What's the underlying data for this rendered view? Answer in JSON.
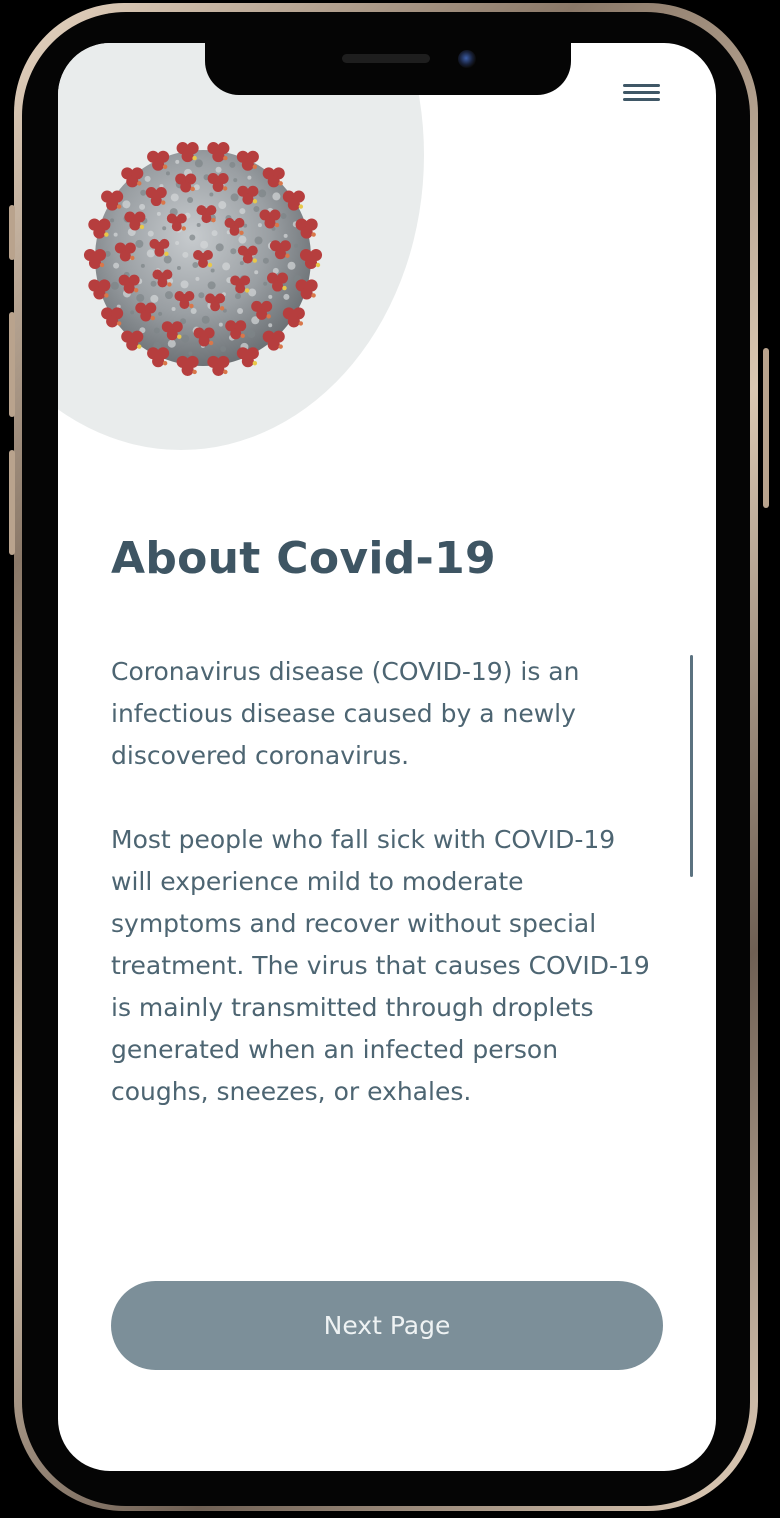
{
  "header": {
    "menu_icon": "hamburger-menu-icon"
  },
  "hero": {
    "image": "coronavirus-illustration"
  },
  "article": {
    "title": "About Covid-19",
    "paragraph_1": "Coronavirus disease (COVID-19) is an infectious disease caused by a newly discovered coronavirus.",
    "paragraph_2": "Most people who fall sick with COVID-19 will experience mild to moderate symptoms and recover without special treatment. The virus that causes COVID-19 is mainly transmitted through droplets generated when an infected person coughs, sneezes, or exhales."
  },
  "footer": {
    "next_label": "Next Page"
  },
  "colors": {
    "accent": "#7c8f99",
    "heading": "#3e5563",
    "body_text": "#4d6572",
    "hero_circle": "#e9ecec",
    "virus_spike": "#b63e3e",
    "virus_body": "#9a9fa3"
  }
}
